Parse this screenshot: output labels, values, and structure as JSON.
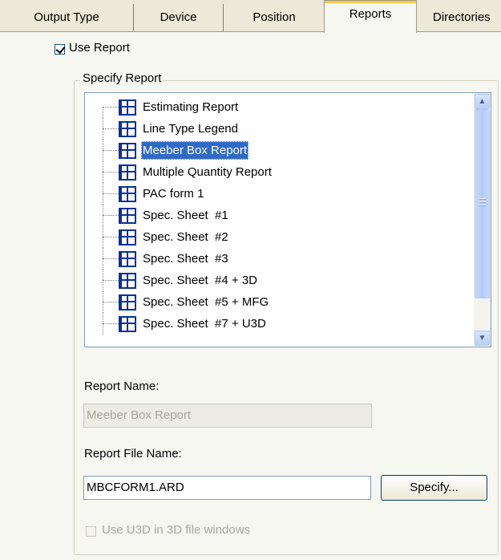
{
  "tabs": [
    {
      "label": "Output Type"
    },
    {
      "label": "Device"
    },
    {
      "label": "Position"
    },
    {
      "label": "Reports"
    },
    {
      "label": "Directories"
    }
  ],
  "use_report": {
    "label": "Use Report",
    "checked": true
  },
  "specify_report": {
    "title": "Specify Report",
    "items": [
      {
        "label": "Estimating Report"
      },
      {
        "label": "Line Type Legend"
      },
      {
        "label": "Meeber Box Report",
        "selected": true
      },
      {
        "label": "Multiple Quantity Report"
      },
      {
        "label": "PAC form 1"
      },
      {
        "label": "Spec. Sheet  #1"
      },
      {
        "label": "Spec. Sheet  #2"
      },
      {
        "label": "Spec. Sheet  #3"
      },
      {
        "label": "Spec. Sheet  #4 + 3D"
      },
      {
        "label": "Spec. Sheet  #5 + MFG"
      },
      {
        "label": "Spec. Sheet  #7 + U3D"
      }
    ]
  },
  "report_name": {
    "label": "Report Name:",
    "value": "Meeber Box Report"
  },
  "report_file_name": {
    "label": "Report File Name:",
    "value": "MBCFORM1.ARD"
  },
  "specify_button": {
    "label": "Specify..."
  },
  "use_u3d": {
    "label": "Use U3D in 3D file windows",
    "checked": false
  },
  "colors": {
    "selection": "#316ac5",
    "panel": "#f7f7f2",
    "active_tab_accent": "#ffc83c"
  }
}
